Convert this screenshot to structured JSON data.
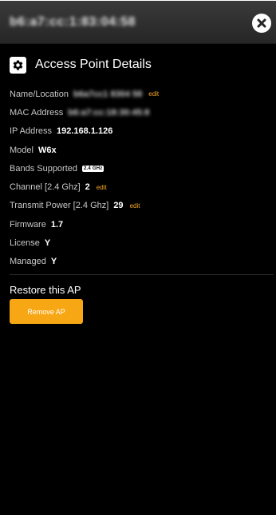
{
  "header": {
    "device_id": "b6:a7:cc:1:83:04:58",
    "close_icon": "close-icon"
  },
  "section": {
    "icon": "gear-icon",
    "title": "Access Point Details"
  },
  "details": {
    "name": {
      "label": "Name/Location",
      "value": "b6a7cc1 8304 58",
      "edit": "edit"
    },
    "mac": {
      "label": "MAC Address",
      "value": "b6:a7:cc:18:30:45:8"
    },
    "ip": {
      "label": "IP Address",
      "value": "192.168.1.126"
    },
    "model": {
      "label": "Model",
      "value": "W6x"
    },
    "bands": {
      "label": "Bands Supported",
      "value": "2.4 GHz"
    },
    "channel": {
      "label": "Channel [2.4 Ghz]",
      "value": "2",
      "edit": "edit"
    },
    "power": {
      "label": "Transmit Power [2.4 Ghz]",
      "value": "29",
      "edit": "edit"
    },
    "firmware": {
      "label": "Firmware",
      "value": "1.7"
    },
    "license": {
      "label": "License",
      "value": "Y"
    },
    "managed": {
      "label": "Managed",
      "value": "Y"
    }
  },
  "restore": {
    "title": "Restore this AP",
    "button_label": "Remove AP"
  },
  "colors": {
    "accent": "#f7a713",
    "edit_link": "#f5a623",
    "background": "#000000",
    "topbar": "#2e2e2e"
  }
}
